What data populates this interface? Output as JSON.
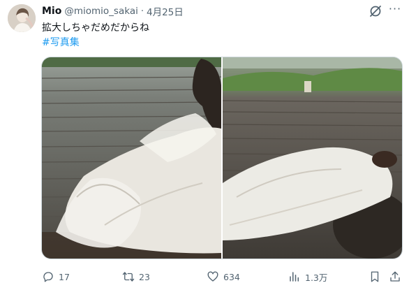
{
  "tweet": {
    "author": {
      "name": "Mio",
      "handle": "@miomio_sakai",
      "separator": "·",
      "date": "4月25日"
    },
    "text": "拡大しちゃだめだからね",
    "hashtag": "#写真集",
    "more_label": "···",
    "media": [
      {
        "icon": "photo",
        "description": ""
      },
      {
        "icon": "photo",
        "description": ""
      }
    ],
    "actions": {
      "replies": "17",
      "reposts": "23",
      "likes": "634",
      "views": "1.3万"
    }
  },
  "colors": {
    "link": "#1d9bf0",
    "muted": "#536471",
    "text": "#0f1419",
    "border": "#cfd9de"
  }
}
